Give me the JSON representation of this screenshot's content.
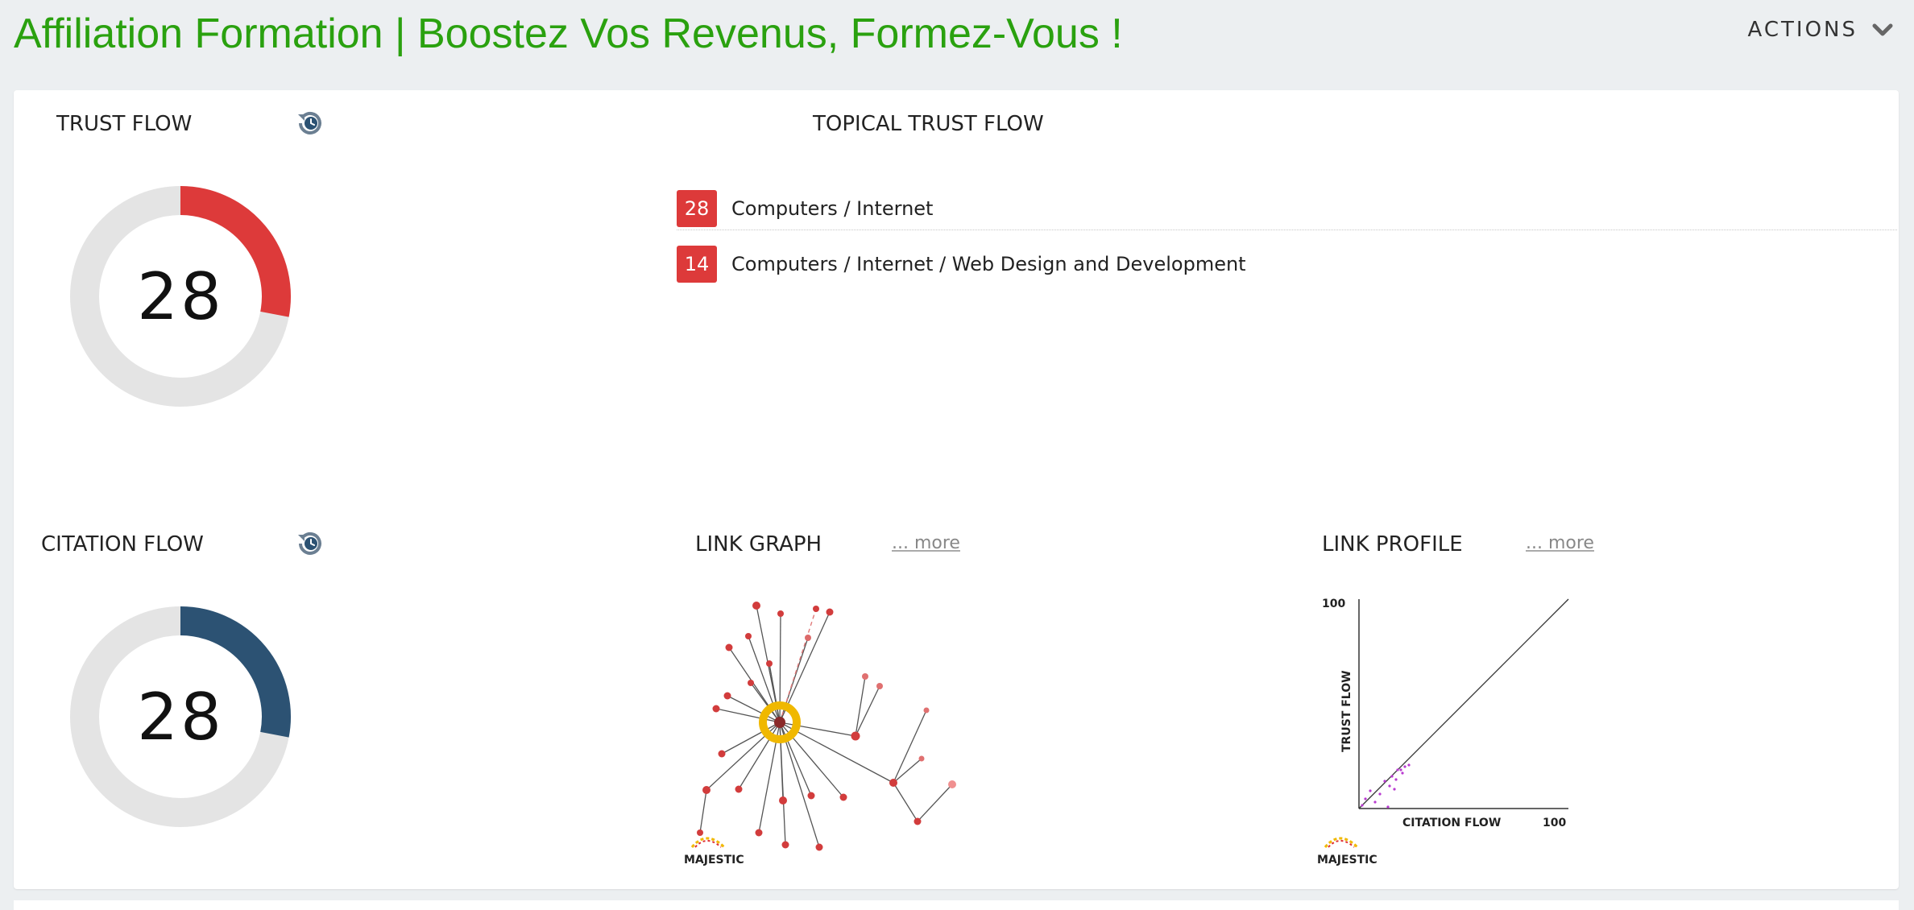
{
  "header": {
    "title": "Affiliation Formation | Boostez Vos Revenus, Formez-Vous !",
    "actions_label": "ACTIONS",
    "title_color": "#2aa10f"
  },
  "trust_flow": {
    "label": "TRUST FLOW",
    "value": "28",
    "value_fraction": 0.28,
    "color": "#dd3a3a",
    "history_icon": "history-icon"
  },
  "citation_flow": {
    "label": "CITATION FLOW",
    "value": "28",
    "value_fraction": 0.28,
    "color": "#2c5273",
    "history_icon": "history-icon"
  },
  "topical_trust_flow": {
    "label": "TOPICAL TRUST FLOW",
    "items": [
      {
        "score": "28",
        "topic": "Computers / Internet"
      },
      {
        "score": "14",
        "topic": "Computers / Internet / Web Design and Development"
      }
    ],
    "badge_color": "#dd3a3a"
  },
  "link_graph": {
    "label": "LINK GRAPH",
    "more": "... more",
    "logo_text": "MAJESTIC"
  },
  "link_profile": {
    "label": "LINK PROFILE",
    "more": "... more",
    "y_axis_label": "TRUST FLOW",
    "x_axis_label": "CITATION FLOW",
    "y_max": "100",
    "x_max": "100",
    "logo_text": "MAJESTIC"
  }
}
